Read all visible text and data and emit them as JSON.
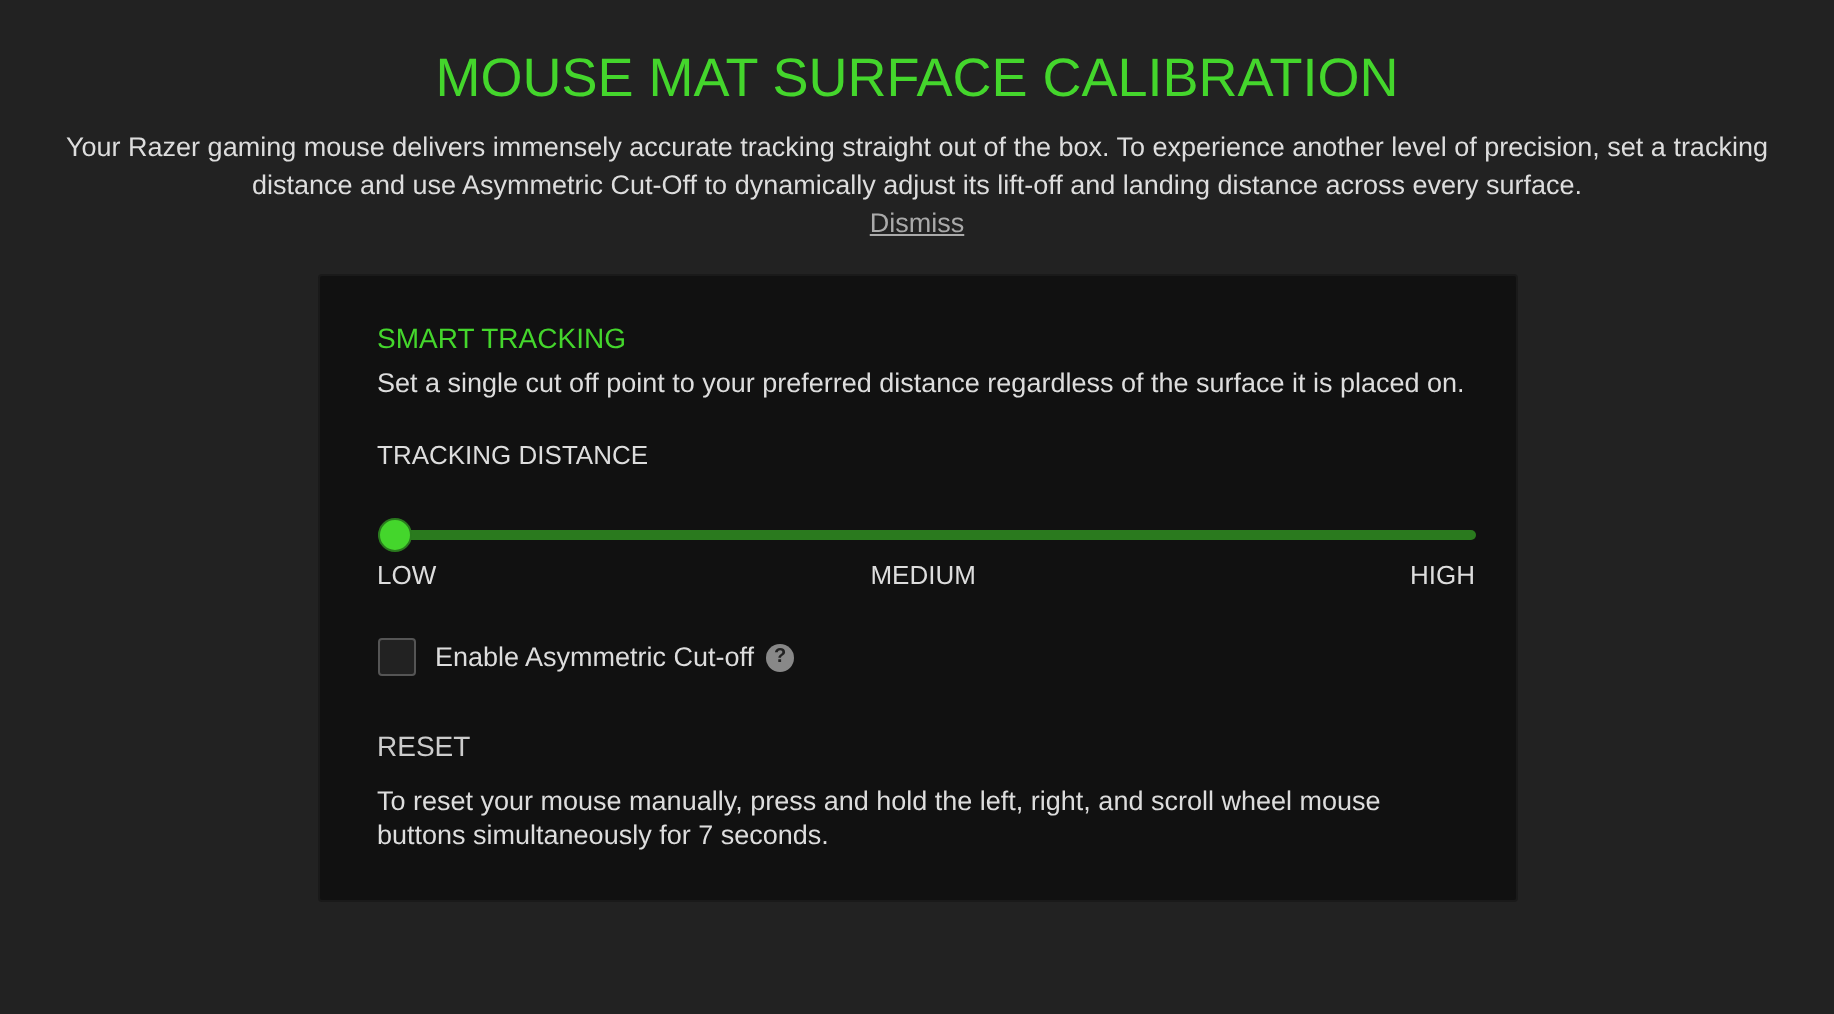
{
  "header": {
    "title": "MOUSE MAT SURFACE CALIBRATION",
    "intro": "Your Razer gaming mouse delivers immensely accurate tracking straight out of the box. To experience another level of precision, set a tracking distance and use Asymmetric Cut-Off to dynamically adjust its lift-off and landing distance across every surface.",
    "dismiss": "Dismiss"
  },
  "smart_tracking": {
    "title": "SMART TRACKING",
    "description": "Set a single cut off point to your preferred distance regardless of the surface it is placed on.",
    "slider_label": "TRACKING DISTANCE",
    "slider": {
      "level": 0,
      "labels": [
        "LOW",
        "MEDIUM",
        "HIGH"
      ]
    },
    "asymmetric": {
      "label": "Enable Asymmetric Cut-off",
      "checked": false,
      "help": "?"
    }
  },
  "reset": {
    "title": "RESET",
    "description": "To reset your mouse manually, press and hold the left, right, and scroll wheel mouse buttons simultaneously for 7 seconds."
  }
}
